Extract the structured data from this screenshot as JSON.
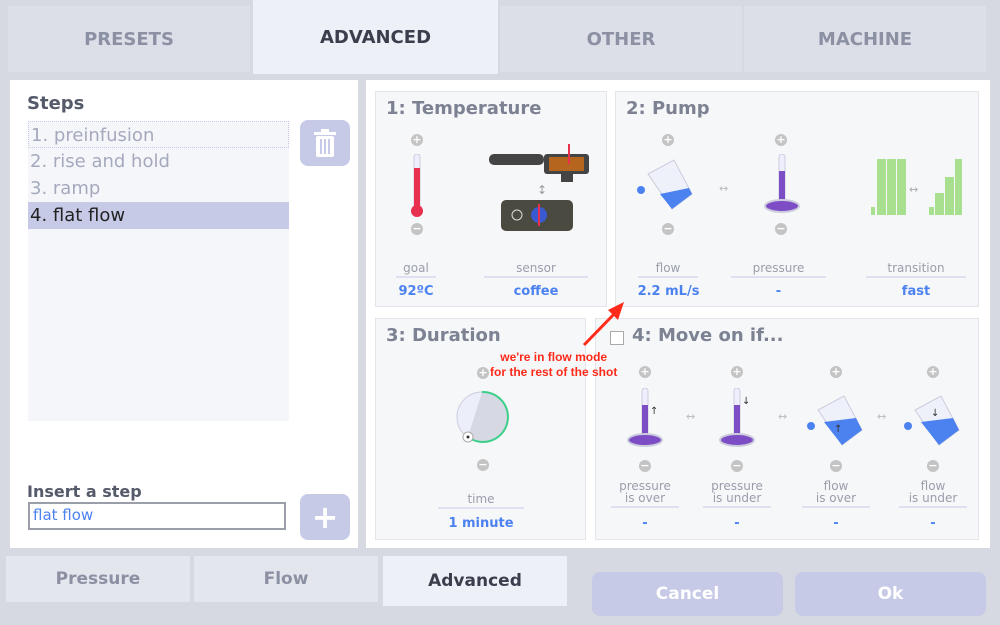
{
  "tabs": [
    "PRESETS",
    "ADVANCED",
    "OTHER",
    "MACHINE"
  ],
  "steps": {
    "title": "Steps",
    "items": [
      "1. preinfusion",
      "2. rise and hold",
      "3. ramp",
      "4. flat flow"
    ],
    "insert_label": "Insert a step",
    "insert_value": "flat flow"
  },
  "temperature": {
    "title": "1: Temperature",
    "goal_label": "goal",
    "goal_value": "92ºC",
    "sensor_label": "sensor",
    "sensor_value": "coffee"
  },
  "pump": {
    "title": "2: Pump",
    "flow_label": "flow",
    "flow_value": "2.2 mL/s",
    "pressure_label": "pressure",
    "pressure_value": "-",
    "transition_label": "transition",
    "transition_value": "fast"
  },
  "duration": {
    "title": "3: Duration",
    "time_label": "time",
    "time_value": "1 minute"
  },
  "moveon": {
    "title": "4: Move on if...",
    "items": [
      {
        "label1": "pressure",
        "label2": "is over",
        "value": "-"
      },
      {
        "label1": "pressure",
        "label2": "is under",
        "value": "-"
      },
      {
        "label1": "flow",
        "label2": "is over",
        "value": "-"
      },
      {
        "label1": "flow",
        "label2": "is under",
        "value": "-"
      }
    ]
  },
  "annotation": {
    "line1": "we're in flow mode",
    "line2": "for the rest of the shot"
  },
  "bottom_tabs": [
    "Pressure",
    "Flow",
    "Advanced"
  ],
  "buttons": {
    "cancel": "Cancel",
    "ok": "Ok"
  },
  "colors": {
    "accent": "#4c82f0",
    "annotation": "#ff2a1a",
    "button": "#c6cae6"
  }
}
